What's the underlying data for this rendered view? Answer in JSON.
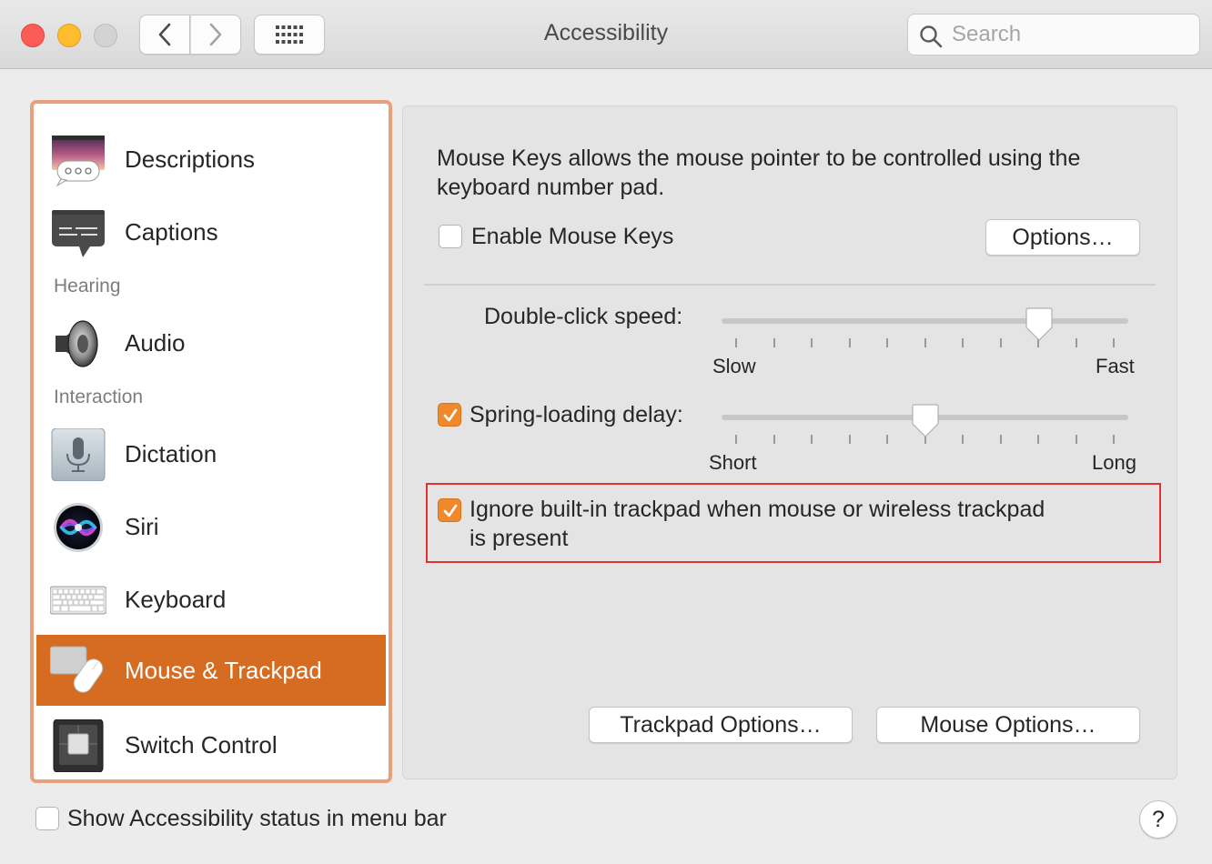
{
  "window": {
    "title": "Accessibility"
  },
  "search": {
    "placeholder": "Search"
  },
  "sidebar": {
    "items": [
      {
        "label": "Descriptions",
        "icon": "descriptions-icon"
      },
      {
        "label": "Captions",
        "icon": "captions-icon"
      },
      {
        "label": "Audio",
        "icon": "speaker-icon"
      },
      {
        "label": "Dictation",
        "icon": "microphone-icon"
      },
      {
        "label": "Siri",
        "icon": "siri-icon"
      },
      {
        "label": "Keyboard",
        "icon": "keyboard-icon"
      },
      {
        "label": "Mouse & Trackpad",
        "icon": "mouse-trackpad-icon",
        "selected": true
      },
      {
        "label": "Switch Control",
        "icon": "switch-control-icon"
      }
    ],
    "sections": {
      "hearing": "Hearing",
      "interaction": "Interaction"
    }
  },
  "main": {
    "description": "Mouse Keys allows the mouse pointer to be controlled using the keyboard number pad.",
    "enable_mouse_keys": {
      "label": "Enable Mouse Keys",
      "checked": false
    },
    "options_button": "Options…",
    "double_click": {
      "label": "Double-click speed:",
      "min_label": "Slow",
      "max_label": "Fast",
      "value": 0.78
    },
    "spring_loading": {
      "label": "Spring-loading delay:",
      "checked": true,
      "min_label": "Short",
      "max_label": "Long",
      "value": 0.5
    },
    "ignore_trackpad": {
      "label_line1": "Ignore built-in trackpad when mouse or wireless trackpad",
      "label_line2": "is present",
      "checked": true
    },
    "trackpad_options_button": "Trackpad Options…",
    "mouse_options_button": "Mouse Options…"
  },
  "footer": {
    "show_status": {
      "label": "Show Accessibility status in menu bar",
      "checked": false
    },
    "help": "?"
  },
  "colors": {
    "accent": "#f0892b",
    "selection": "#d66c21",
    "highlight": "#e2322d"
  }
}
